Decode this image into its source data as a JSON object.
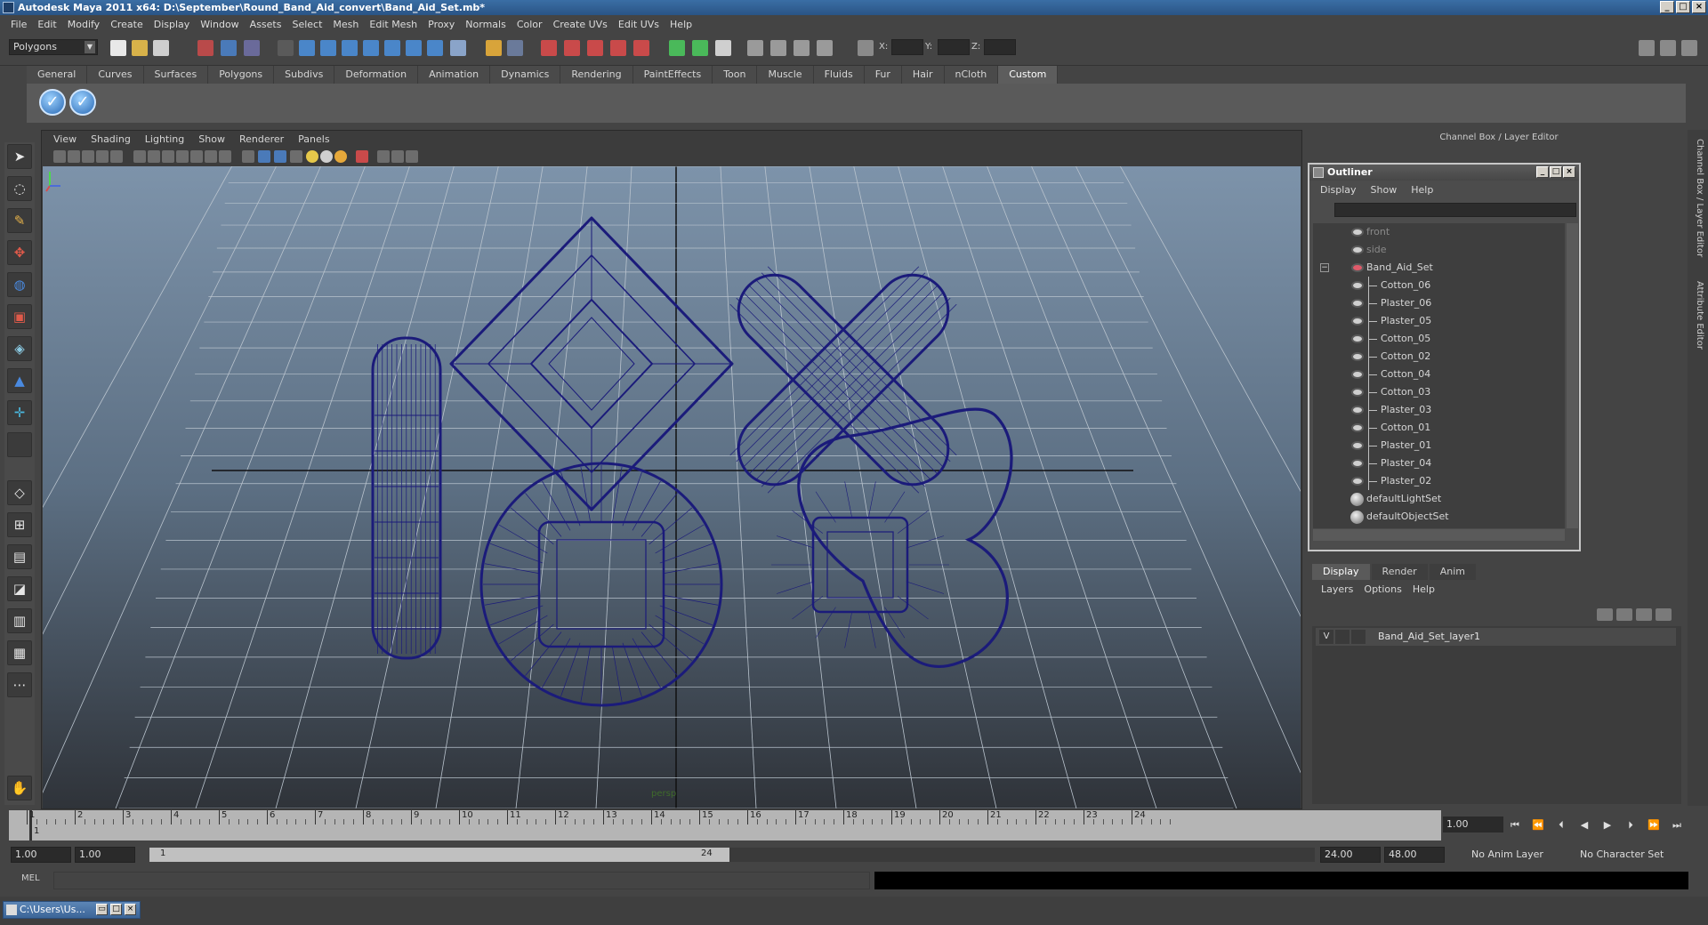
{
  "window": {
    "title": "Autodesk Maya 2011 x64: D:\\September\\Round_Band_Aid_convert\\Band_Aid_Set.mb*"
  },
  "menubar": [
    "File",
    "Edit",
    "Modify",
    "Create",
    "Display",
    "Window",
    "Assets",
    "Select",
    "Mesh",
    "Edit Mesh",
    "Proxy",
    "Normals",
    "Color",
    "Create UVs",
    "Edit UVs",
    "Help"
  ],
  "status_line": {
    "mode": "Polygons",
    "x_label": "X:",
    "y_label": "Y:",
    "z_label": "Z:"
  },
  "shelf": {
    "tabs": [
      "General",
      "Curves",
      "Surfaces",
      "Polygons",
      "Subdivs",
      "Deformation",
      "Animation",
      "Dynamics",
      "Rendering",
      "PaintEffects",
      "Toon",
      "Muscle",
      "Fluids",
      "Fur",
      "Hair",
      "nCloth",
      "Custom"
    ],
    "active_tab": "Custom",
    "icons": [
      "check-icon",
      "check-icon"
    ]
  },
  "viewport": {
    "menus": [
      "View",
      "Shading",
      "Lighting",
      "Show",
      "Renderer",
      "Panels"
    ],
    "camera_label": "persp",
    "wire_color": "#1b1b7a"
  },
  "channel_box": {
    "header": "Channel Box / Layer Editor",
    "side_tabs": [
      "Channel Box / Layer Editor",
      "Attribute Editor"
    ]
  },
  "outliner": {
    "title": "Outliner",
    "menus": [
      "Display",
      "Show",
      "Help"
    ],
    "items": [
      {
        "label": "front",
        "type": "camera",
        "dim": true
      },
      {
        "label": "side",
        "type": "camera",
        "dim": true
      },
      {
        "label": "Band_Aid_Set",
        "type": "group",
        "expanded": true
      },
      {
        "label": "Cotton_06",
        "type": "child"
      },
      {
        "label": "Plaster_06",
        "type": "child"
      },
      {
        "label": "Plaster_05",
        "type": "child"
      },
      {
        "label": "Cotton_05",
        "type": "child"
      },
      {
        "label": "Cotton_02",
        "type": "child"
      },
      {
        "label": "Cotton_04",
        "type": "child"
      },
      {
        "label": "Cotton_03",
        "type": "child"
      },
      {
        "label": "Plaster_03",
        "type": "child"
      },
      {
        "label": "Cotton_01",
        "type": "child"
      },
      {
        "label": "Plaster_01",
        "type": "child"
      },
      {
        "label": "Plaster_04",
        "type": "child"
      },
      {
        "label": "Plaster_02",
        "type": "child"
      },
      {
        "label": "defaultLightSet",
        "type": "set"
      },
      {
        "label": "defaultObjectSet",
        "type": "set"
      }
    ]
  },
  "layer_editor": {
    "tabs": [
      "Display",
      "Render",
      "Anim"
    ],
    "active_tab": "Display",
    "menus": [
      "Layers",
      "Options",
      "Help"
    ],
    "layers": [
      {
        "visible": "V",
        "name": "Band_Aid_Set_layer1"
      }
    ]
  },
  "time_slider": {
    "ticks": [
      1,
      2,
      3,
      4,
      5,
      6,
      7,
      8,
      9,
      10,
      11,
      12,
      13,
      14,
      15,
      16,
      17,
      18,
      19,
      20,
      21,
      22,
      23,
      24
    ],
    "current_frame_marker": "1",
    "current_frame": "1.00"
  },
  "range_slider": {
    "start_time": "1.00",
    "playback_start": "1.00",
    "range_low": "1",
    "range_high": "24",
    "playback_end": "24.00",
    "end_time": "48.00",
    "anim_layer": "No Anim Layer",
    "character_set": "No Character Set"
  },
  "command_line": {
    "label": "MEL"
  },
  "taskbar": {
    "task_label": "C:\\Users\\Us..."
  }
}
